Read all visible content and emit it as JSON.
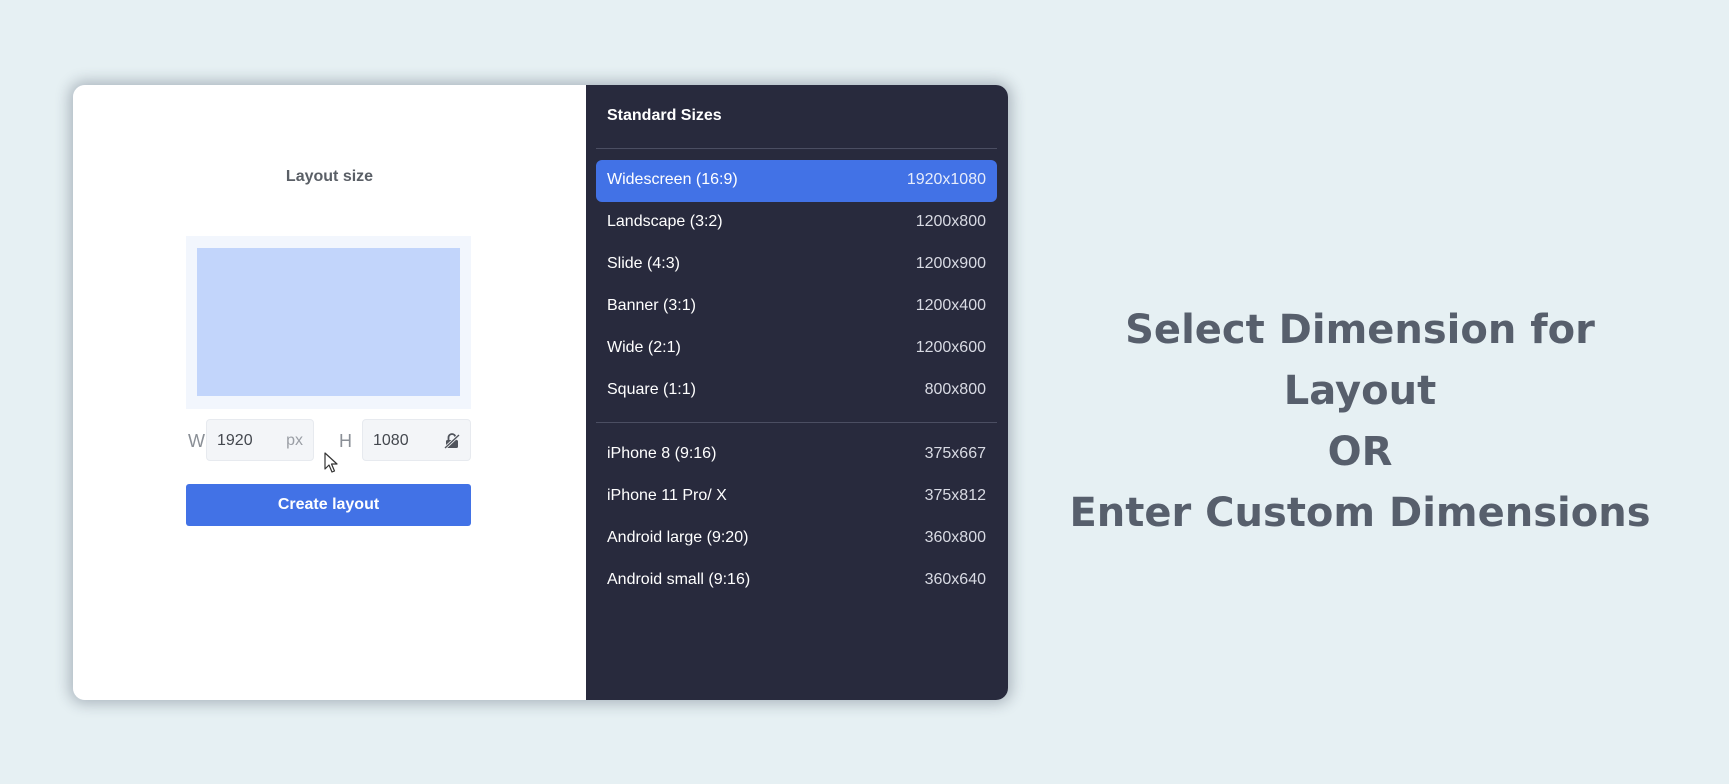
{
  "left": {
    "title": "Layout size",
    "width_label": "W",
    "width_value": "1920",
    "width_unit": "px",
    "height_label": "H",
    "height_value": "1080",
    "lock_icon": "lock-aspect-icon",
    "create_button": "Create layout"
  },
  "sizes": {
    "title": "Standard Sizes",
    "standard": [
      {
        "name": "Widescreen (16:9)",
        "dims": "1920x1080",
        "selected": true
      },
      {
        "name": "Landscape (3:2)",
        "dims": "1200x800"
      },
      {
        "name": "Slide (4:3)",
        "dims": "1200x900"
      },
      {
        "name": "Banner (3:1)",
        "dims": "1200x400"
      },
      {
        "name": "Wide (2:1)",
        "dims": "1200x600"
      },
      {
        "name": "Square (1:1)",
        "dims": "800x800"
      }
    ],
    "mobile": [
      {
        "name": "iPhone 8 (9:16)",
        "dims": "375x667"
      },
      {
        "name": "iPhone 11 Pro/ X",
        "dims": "375x812"
      },
      {
        "name": "Android large (9:20)",
        "dims": "360x800"
      },
      {
        "name": "Android small (9:16)",
        "dims": "360x640"
      }
    ]
  },
  "caption": {
    "line1": "Select Dimension for Layout",
    "line2": "OR",
    "line3": "Enter Custom Dimensions"
  },
  "colors": {
    "accent": "#4272e6",
    "panel_bg": "#282a3d",
    "page_bg": "#e6f0f3",
    "preview_fill": "#c2d5fb"
  }
}
